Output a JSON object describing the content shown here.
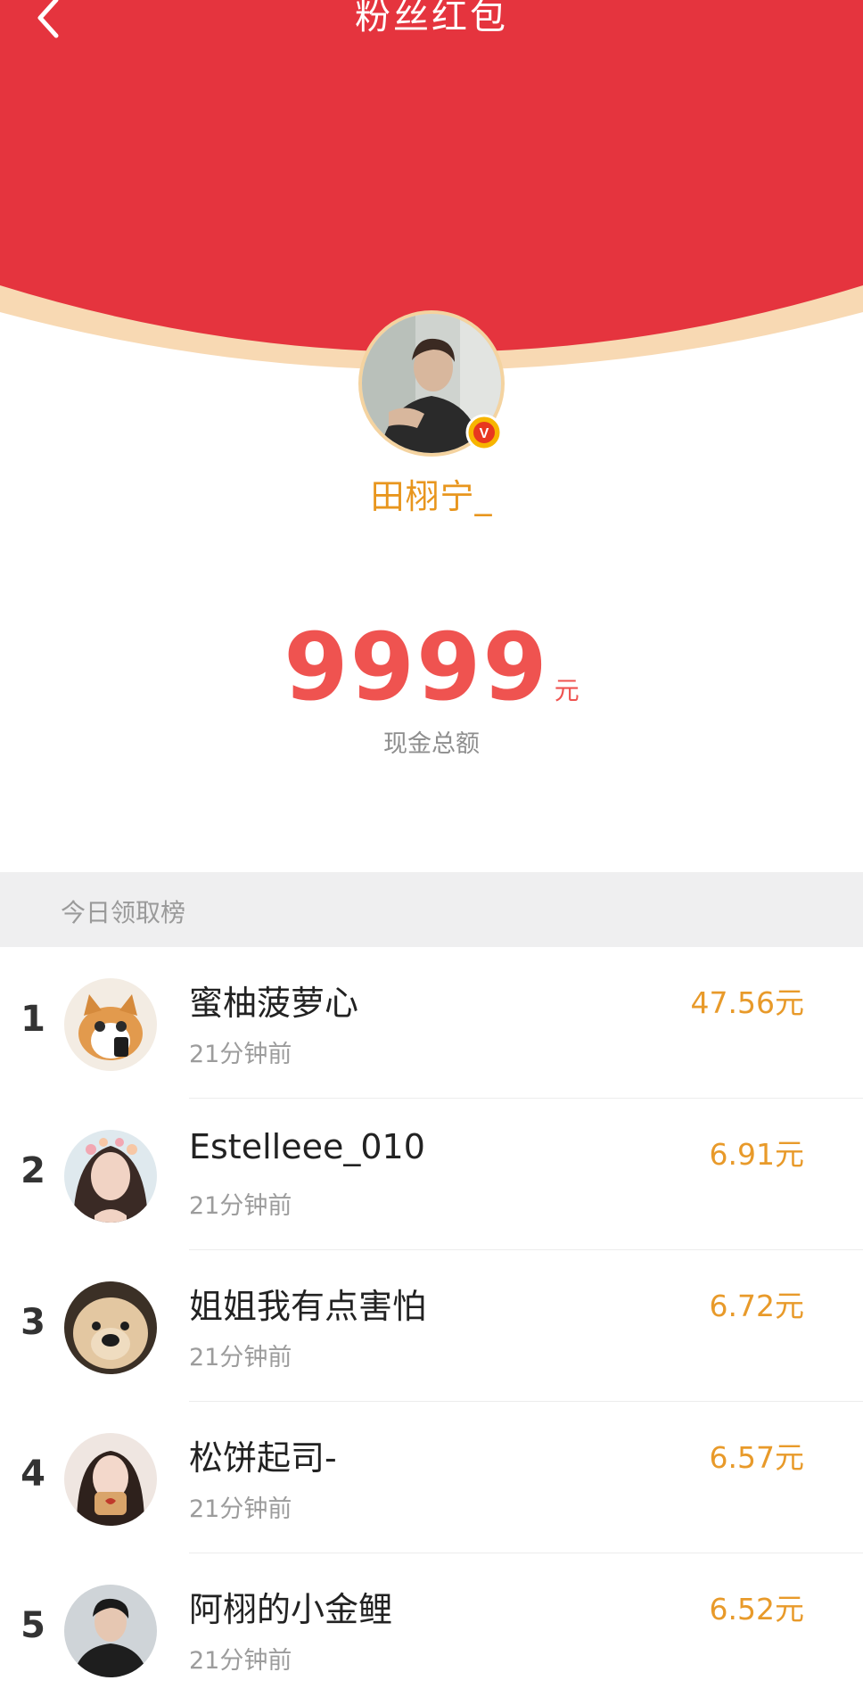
{
  "header": {
    "title": "粉丝红包",
    "colors": {
      "red": "#e5343e",
      "gold_edge": "#f8d9b3"
    }
  },
  "profile": {
    "username": "田栩宁_",
    "badge_letter": "V"
  },
  "total": {
    "amount": "9999",
    "unit": "元",
    "label": "现金总额"
  },
  "ranking": {
    "title": "今日领取榜",
    "rows": [
      {
        "rank": "1",
        "name": "蜜柚菠萝心",
        "time": "21分钟前",
        "amount": "47.56元"
      },
      {
        "rank": "2",
        "name": "Estelleee_010",
        "time": "21分钟前",
        "amount": "6.91元"
      },
      {
        "rank": "3",
        "name": "姐姐我有点害怕",
        "time": "21分钟前",
        "amount": "6.72元"
      },
      {
        "rank": "4",
        "name": "松饼起司-",
        "time": "21分钟前",
        "amount": "6.57元"
      },
      {
        "rank": "5",
        "name": "阿栩的小金鲤",
        "time": "21分钟前",
        "amount": "6.52元"
      }
    ]
  }
}
